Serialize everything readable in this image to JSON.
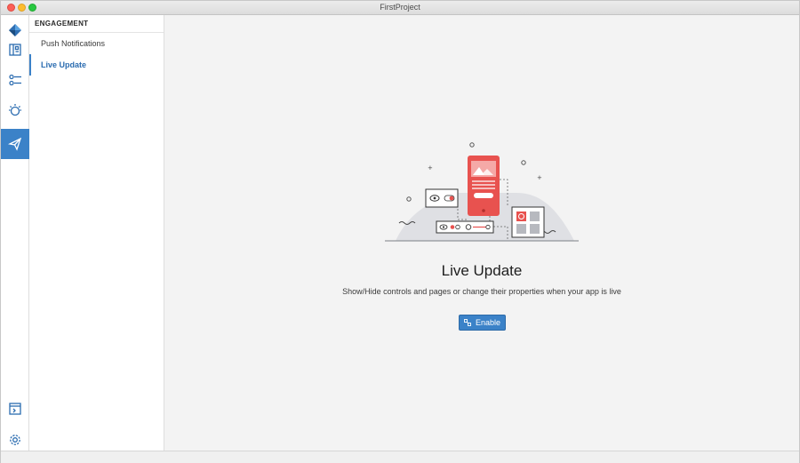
{
  "window": {
    "title": "FirstProject"
  },
  "rail": {
    "items": [
      {
        "icon": "logo-icon"
      },
      {
        "icon": "dashboard-icon"
      },
      {
        "icon": "sliders-icon"
      },
      {
        "icon": "bulb-icon"
      },
      {
        "icon": "paper-plane-icon",
        "active": true
      },
      {
        "icon": "terminal-icon"
      },
      {
        "icon": "gear-icon"
      }
    ],
    "accent": "#3b82c8"
  },
  "subnav": {
    "header": "ENGAGEMENT",
    "items": [
      {
        "label": "Push Notifications",
        "active": false
      },
      {
        "label": "Live Update",
        "active": true
      }
    ]
  },
  "main": {
    "title": "Live Update",
    "description": "Show/Hide controls and pages or change their properties when your app is live",
    "enable_label": "Enable"
  },
  "colors": {
    "accent": "#3b82c8",
    "illustration_red": "#e8524f"
  }
}
